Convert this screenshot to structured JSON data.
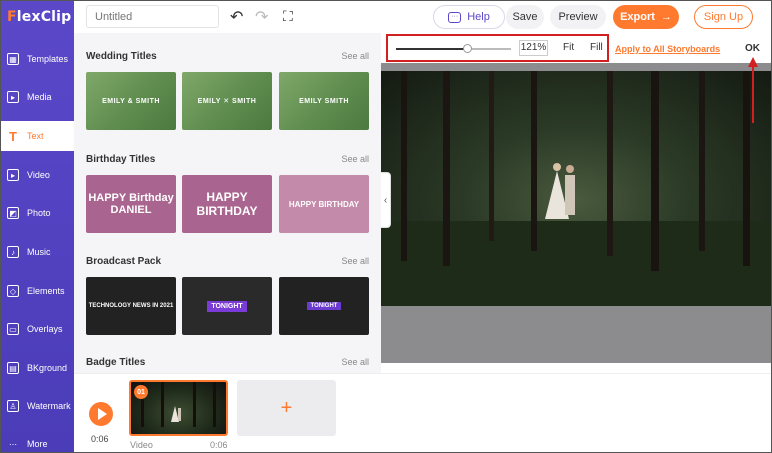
{
  "app": {
    "logo_f": "F",
    "logo_rest": "lexClip"
  },
  "sidebar": {
    "items": [
      {
        "label": "Templates",
        "icon": "templates-icon",
        "glyph": "▦"
      },
      {
        "label": "Media",
        "icon": "media-icon",
        "glyph": "▸"
      },
      {
        "label": "Text",
        "icon": "text-icon",
        "glyph": "T",
        "active": true
      },
      {
        "label": "Video",
        "icon": "video-icon",
        "glyph": "▸"
      },
      {
        "label": "Photo",
        "icon": "photo-icon",
        "glyph": "◩"
      },
      {
        "label": "Music",
        "icon": "music-icon",
        "glyph": "♪"
      },
      {
        "label": "Elements",
        "icon": "elements-icon",
        "glyph": "◇"
      },
      {
        "label": "Overlays",
        "icon": "overlays-icon",
        "glyph": "▭"
      },
      {
        "label": "BKground",
        "icon": "background-icon",
        "glyph": "▤"
      },
      {
        "label": "Watermark",
        "icon": "watermark-icon",
        "glyph": "♙"
      },
      {
        "label": "More",
        "icon": "more-icon",
        "glyph": "⋯"
      }
    ]
  },
  "topbar": {
    "title_placeholder": "Untitled",
    "help_label": "Help",
    "save_label": "Save",
    "preview_label": "Preview",
    "export_label": "Export",
    "signup_label": "Sign Up"
  },
  "panel": {
    "sections": [
      {
        "title": "Wedding Titles",
        "see_all": "See all",
        "thumbs": [
          "EMILY & SMITH",
          "EMILY ✕ SMITH",
          "EMILY SMITH"
        ]
      },
      {
        "title": "Birthday Titles",
        "see_all": "See all",
        "thumbs": [
          "HAPPY Birthday DANIEL",
          "HAPPY BIRTHDAY",
          "HAPPY BIRTHDAY"
        ]
      },
      {
        "title": "Broadcast Pack",
        "see_all": "See all",
        "thumbs": [
          "TECHNOLOGY NEWS IN 2021",
          "TONIGHT",
          "TONIGHT"
        ]
      },
      {
        "title": "Badge Titles",
        "see_all": "See all"
      }
    ]
  },
  "zoom": {
    "value": "121%",
    "fit_label": "Fit",
    "fill_label": "Fill",
    "slider_fraction": 0.62
  },
  "canvas": {
    "apply_all_label": "Apply to All Storyboards",
    "ok_label": "OK"
  },
  "timeline": {
    "current_time": "0:06",
    "clips": [
      {
        "number": "01",
        "label": "Video",
        "duration": "0:06"
      }
    ],
    "add_label": "+"
  },
  "colors": {
    "accent": "#ff7a2f",
    "brand_purple": "#5a48c9",
    "highlight_red": "#d21f1f"
  }
}
